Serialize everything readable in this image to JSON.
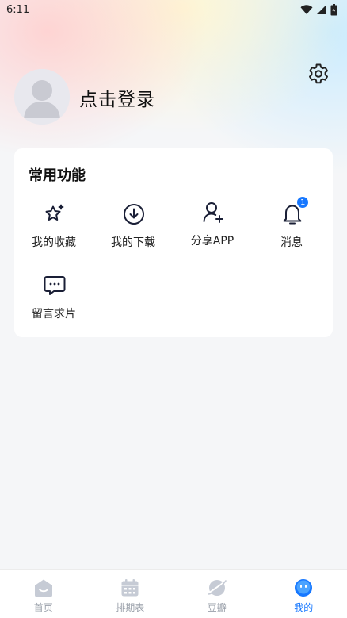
{
  "status_bar": {
    "time": "6:11",
    "icons": [
      "wifi-icon",
      "cellular-signal-icon",
      "battery-icon"
    ]
  },
  "header": {
    "settings_icon": "gear-icon",
    "avatar_icon": "default-user-avatar",
    "login_label": "点击登录"
  },
  "functions": {
    "title": "常用功能",
    "items": [
      {
        "label": "我的收藏",
        "icon": "star-sparkle-icon"
      },
      {
        "label": "我的下载",
        "icon": "download-icon"
      },
      {
        "label": "分享APP",
        "icon": "add-user-icon"
      },
      {
        "label": "消息",
        "icon": "bell-icon",
        "badge": "1"
      },
      {
        "label": "留言求片",
        "icon": "message-bubble-icon"
      }
    ]
  },
  "tabbar": {
    "tabs": [
      {
        "label": "首页",
        "icon": "home-icon",
        "active": false
      },
      {
        "label": "排期表",
        "icon": "calendar-icon",
        "active": false
      },
      {
        "label": "豆瓣",
        "icon": "planet-icon",
        "active": false
      },
      {
        "label": "我的",
        "icon": "face-icon",
        "active": true
      }
    ]
  },
  "colors": {
    "accent": "#1677ff",
    "inactive": "#9aa0aa",
    "background": "#f5f6f8",
    "card": "#ffffff"
  }
}
